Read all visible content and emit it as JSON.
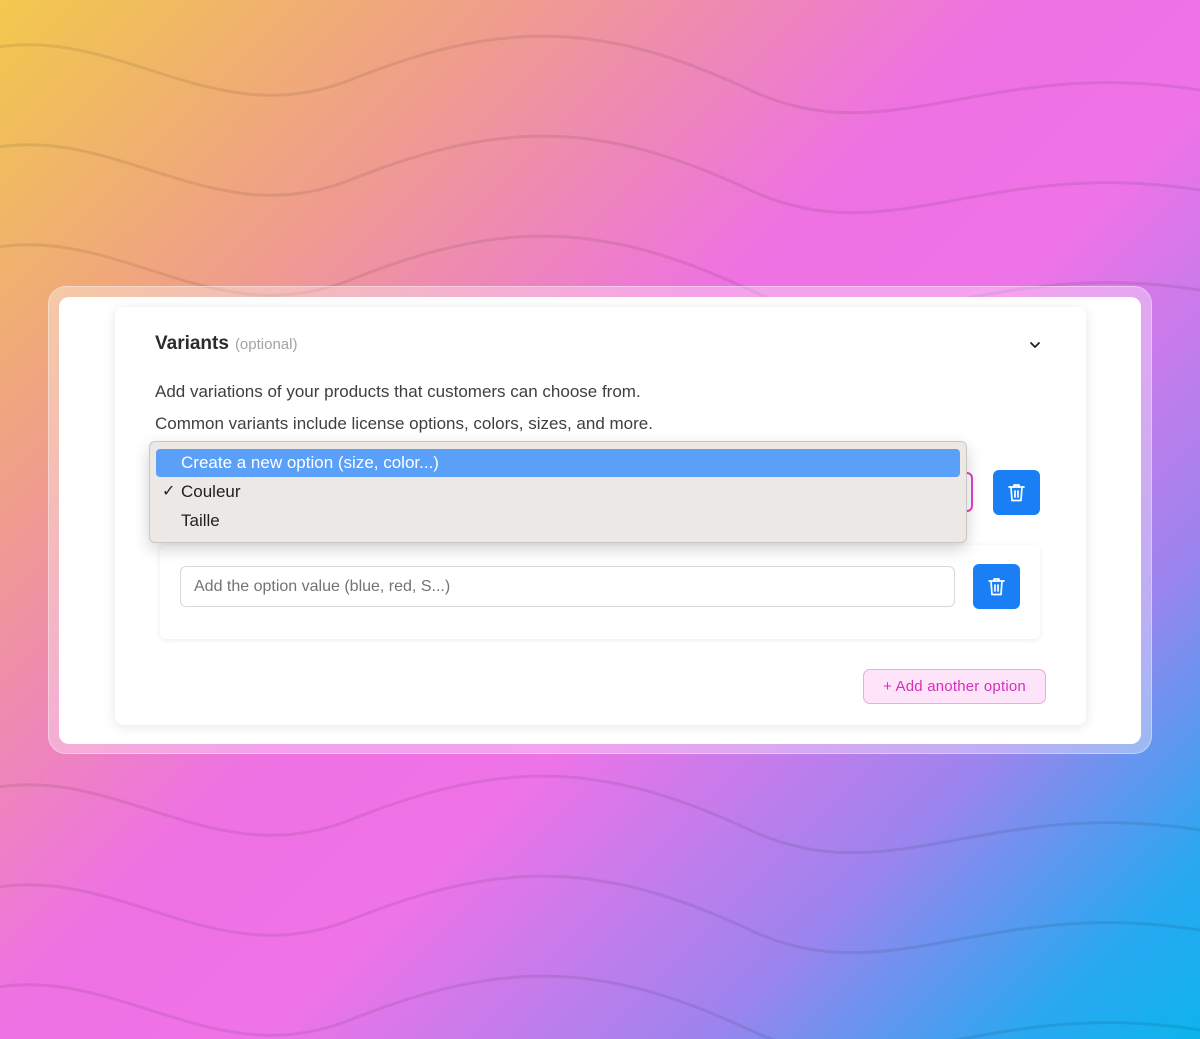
{
  "variants": {
    "title": "Variants",
    "optional_label": "(optional)",
    "description_line1": "Add variations of your products that customers can choose from.",
    "description_line2": "Common variants include license options, colors, sizes, and more."
  },
  "dropdown": {
    "items": [
      {
        "label": "Create a new option (size, color...)",
        "highlighted": true,
        "checked": false
      },
      {
        "label": "Couleur",
        "highlighted": false,
        "checked": true
      },
      {
        "label": "Taille",
        "highlighted": false,
        "checked": false
      }
    ],
    "check_glyph": "✓"
  },
  "option_value": {
    "placeholder": "Add the option value (blue, red, S...)"
  },
  "actions": {
    "add_another_option": "+ Add another option"
  },
  "icons": {
    "collapse": "chevron-down-icon",
    "delete": "trash-icon"
  },
  "colors": {
    "primary_blue": "#1a7ff5",
    "accent_pink": "#e040c8",
    "highlight_blue": "#5aa0f8"
  }
}
